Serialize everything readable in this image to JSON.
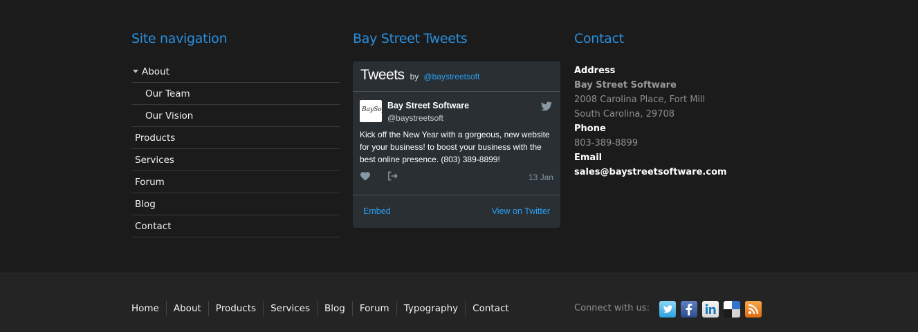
{
  "site_navigation": {
    "heading": "Site navigation",
    "items": [
      {
        "label": "About"
      },
      {
        "label": "Our Team"
      },
      {
        "label": "Our Vision"
      },
      {
        "label": "Products"
      },
      {
        "label": "Services"
      },
      {
        "label": "Forum"
      },
      {
        "label": "Blog"
      },
      {
        "label": "Contact"
      }
    ]
  },
  "tweets_section": {
    "heading": "Bay Street Tweets",
    "widget": {
      "title": "Tweets",
      "by": "by",
      "handle_link": "@baystreetsoft",
      "tweet": {
        "author_name": "Bay Street Software",
        "author_handle": "@baystreetsoft",
        "text": "Kick off the New Year with a gorgeous, new website for your business! to boost your business with the best online presence. (803) 389-8899!",
        "date": "13 Jan"
      },
      "embed_label": "Embed",
      "view_label": "View on Twitter"
    }
  },
  "contact": {
    "heading": "Contact",
    "address_label": "Address",
    "company": "Bay Street Software",
    "address_line1": "2008 Carolina Place, Fort Mill",
    "address_line2": "South Carolina, 29708",
    "phone_label": "Phone",
    "phone": "803-389-8899",
    "email_label": "Email",
    "email": "sales@baystreetsoftware.com"
  },
  "footer": {
    "nav": [
      {
        "label": "Home"
      },
      {
        "label": "About"
      },
      {
        "label": "Products"
      },
      {
        "label": "Services"
      },
      {
        "label": "Blog"
      },
      {
        "label": "Forum"
      },
      {
        "label": "Typography"
      },
      {
        "label": "Contact"
      }
    ],
    "connect_label": "Connect with us:",
    "social_icons": [
      "twitter-icon",
      "facebook-icon",
      "linkedin-icon",
      "delicious-icon",
      "rss-icon"
    ]
  },
  "colors": {
    "background": "#1b1b1b",
    "footer_background": "#242424",
    "heading_blue": "#2b8fdc",
    "tweet_card": "#292f33",
    "link_blue": "#2b9ef2"
  }
}
